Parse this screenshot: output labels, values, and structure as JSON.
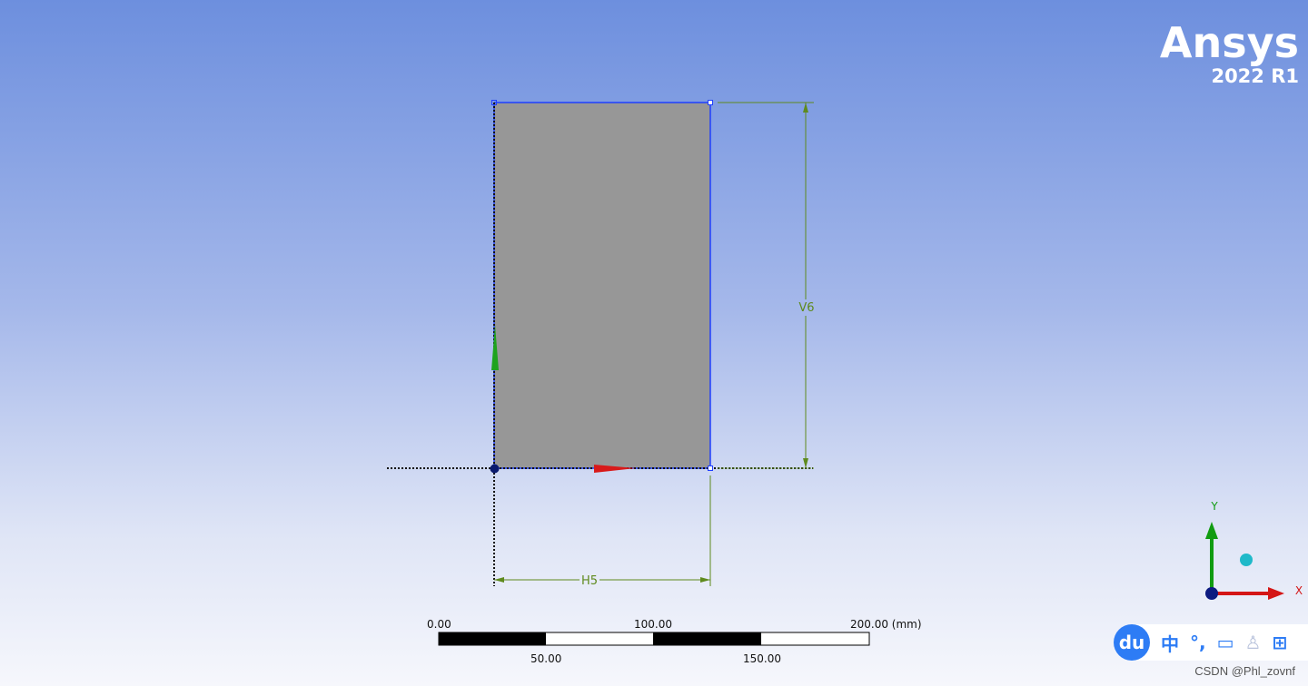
{
  "brand": {
    "name": "Ansys",
    "version": "2022 R1"
  },
  "dimensions": {
    "vertical": "V6",
    "horizontal": "H5"
  },
  "scale_bar": {
    "top_labels": [
      "0.00",
      "100.00",
      "200.00 (mm)"
    ],
    "bottom_labels": [
      "50.00",
      "150.00"
    ]
  },
  "axes": {
    "y_label": "Y",
    "x_label": "X"
  },
  "ime_toolbar": {
    "logo": "du",
    "items": [
      "中",
      "°,",
      "▭",
      "♙",
      "⊞"
    ]
  },
  "watermark": "CSDN @Phl_zovnf",
  "colors": {
    "sketch_edges": "#1f3fff",
    "fill": "#979797",
    "dimension": "#5e8a1d",
    "x_axis": "#dd1111",
    "y_axis": "#11aa11",
    "ime_blue": "#2d7cf5"
  }
}
